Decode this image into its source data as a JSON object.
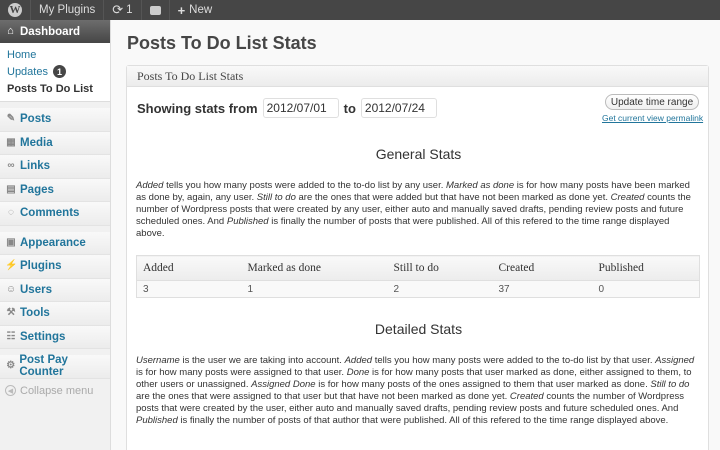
{
  "adminbar": {
    "site_name": "My Plugins",
    "updates_count": "1",
    "new_label": "New"
  },
  "sidebar": {
    "dashboard_label": "Dashboard",
    "submenu": [
      {
        "label": "Home"
      },
      {
        "label": "Updates",
        "badge": "1"
      },
      {
        "label": "Posts To Do List"
      }
    ],
    "items": [
      {
        "label": "Posts",
        "icon": "pin-icon"
      },
      {
        "label": "Media",
        "icon": "media-icon"
      },
      {
        "label": "Links",
        "icon": "link-icon"
      },
      {
        "label": "Pages",
        "icon": "pages-icon"
      },
      {
        "label": "Comments",
        "icon": "comments-icon"
      },
      {
        "label": "Appearance",
        "icon": "appearance-icon"
      },
      {
        "label": "Plugins",
        "icon": "plugins-icon"
      },
      {
        "label": "Users",
        "icon": "users-icon"
      },
      {
        "label": "Tools",
        "icon": "tools-icon"
      },
      {
        "label": "Settings",
        "icon": "settings-icon"
      },
      {
        "label": "Post Pay Counter",
        "icon": "gear-icon"
      }
    ],
    "collapse_label": "Collapse menu"
  },
  "page": {
    "title": "Posts To Do List Stats",
    "box_title": "Posts To Do List Stats",
    "range_prefix": "Showing stats from",
    "date_from": "2012/07/01",
    "range_to": "to",
    "date_to": "2012/07/24",
    "update_button": "Update time range",
    "permalink": "Get current view permalink"
  },
  "general": {
    "title": "General Stats",
    "table_headers": [
      "Added",
      "Marked as done",
      "Still to do",
      "Created",
      "Published"
    ],
    "table_row": [
      "3",
      "1",
      "2",
      "37",
      "0"
    ]
  },
  "detailed": {
    "title": "Detailed Stats"
  },
  "colors": {
    "adminbar": "#464646",
    "link": "#21759b",
    "menu_head": "#464646"
  }
}
